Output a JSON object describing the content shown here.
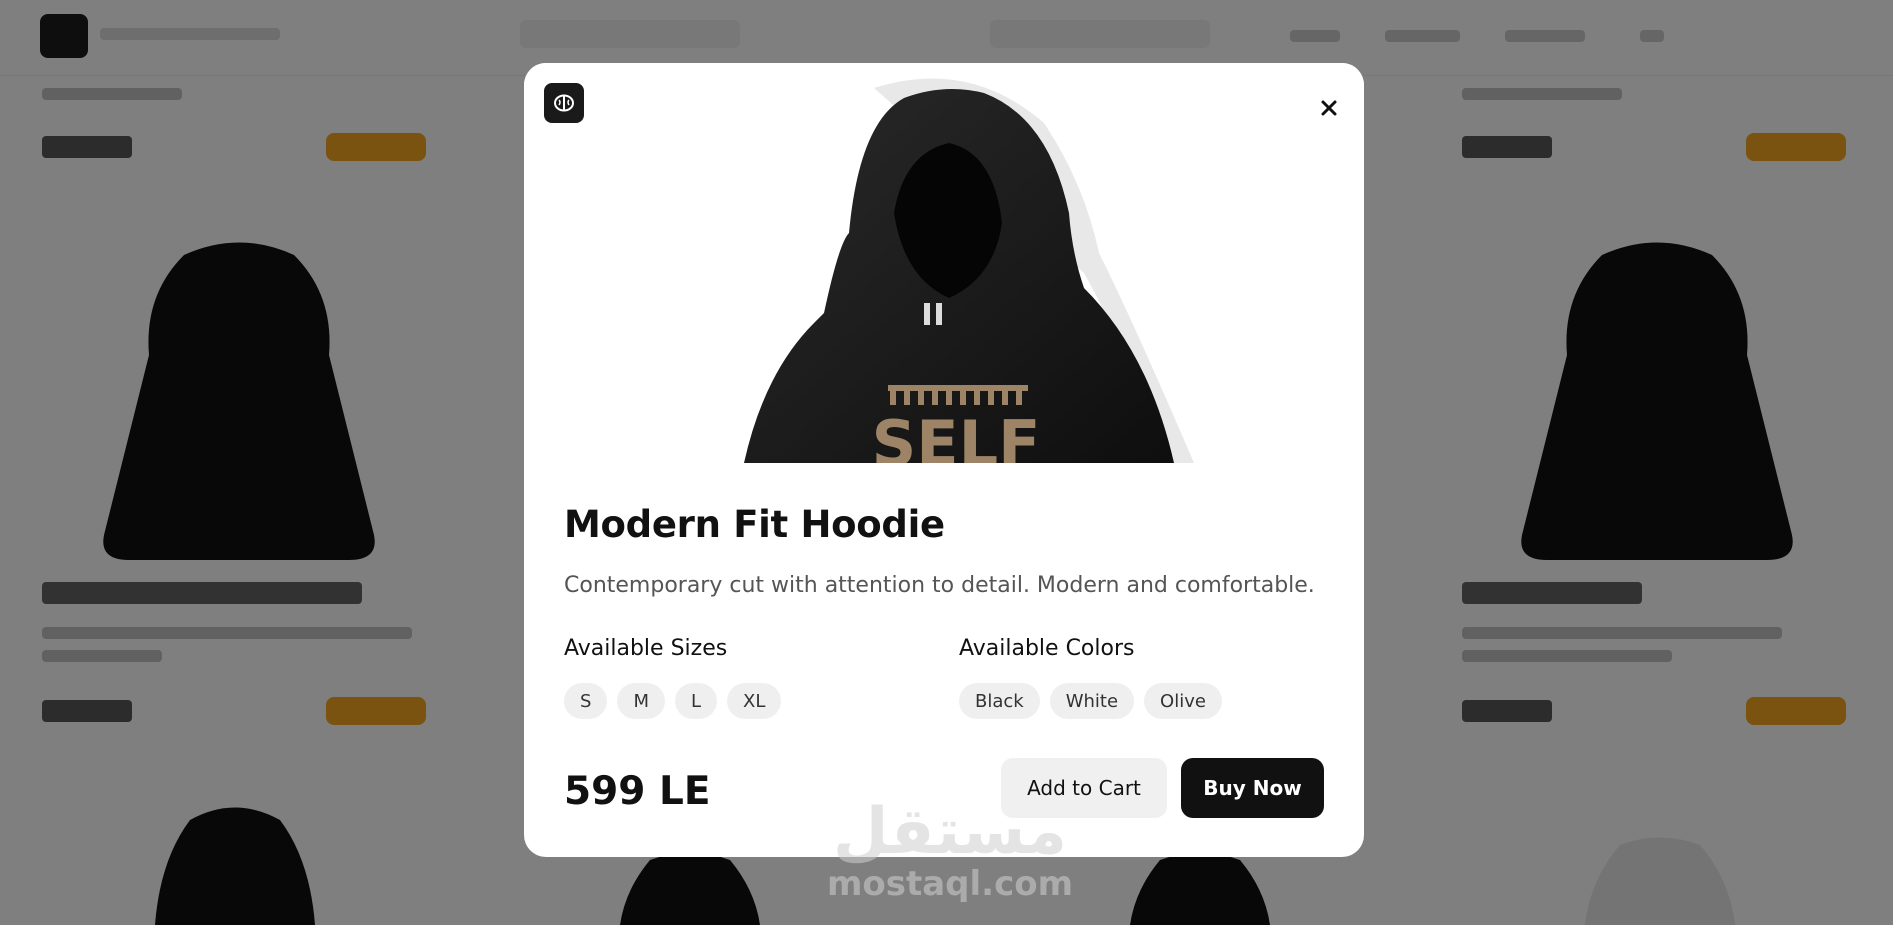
{
  "modal": {
    "brand_icon": "brain-icon",
    "close_icon": "close-icon",
    "product_image_text": "SELF",
    "title": "Modern Fit Hoodie",
    "description": "Contemporary cut with attention to detail. Modern and comfortable.",
    "sizes_label": "Available Sizes",
    "sizes": [
      "S",
      "M",
      "L",
      "XL"
    ],
    "colors_label": "Available Colors",
    "colors": [
      "Black",
      "White",
      "Olive"
    ],
    "price": "599 LE",
    "add_to_cart_label": "Add to Cart",
    "buy_now_label": "Buy Now"
  },
  "watermark": {
    "arabic": "مستقل",
    "latin": "mostaql.com"
  },
  "colors": {
    "overlay": "#00000080",
    "primary_button": "#111111",
    "secondary_button": "#f0f0f0",
    "chip": "#efefef",
    "accent_background_button": "#f5a623"
  }
}
